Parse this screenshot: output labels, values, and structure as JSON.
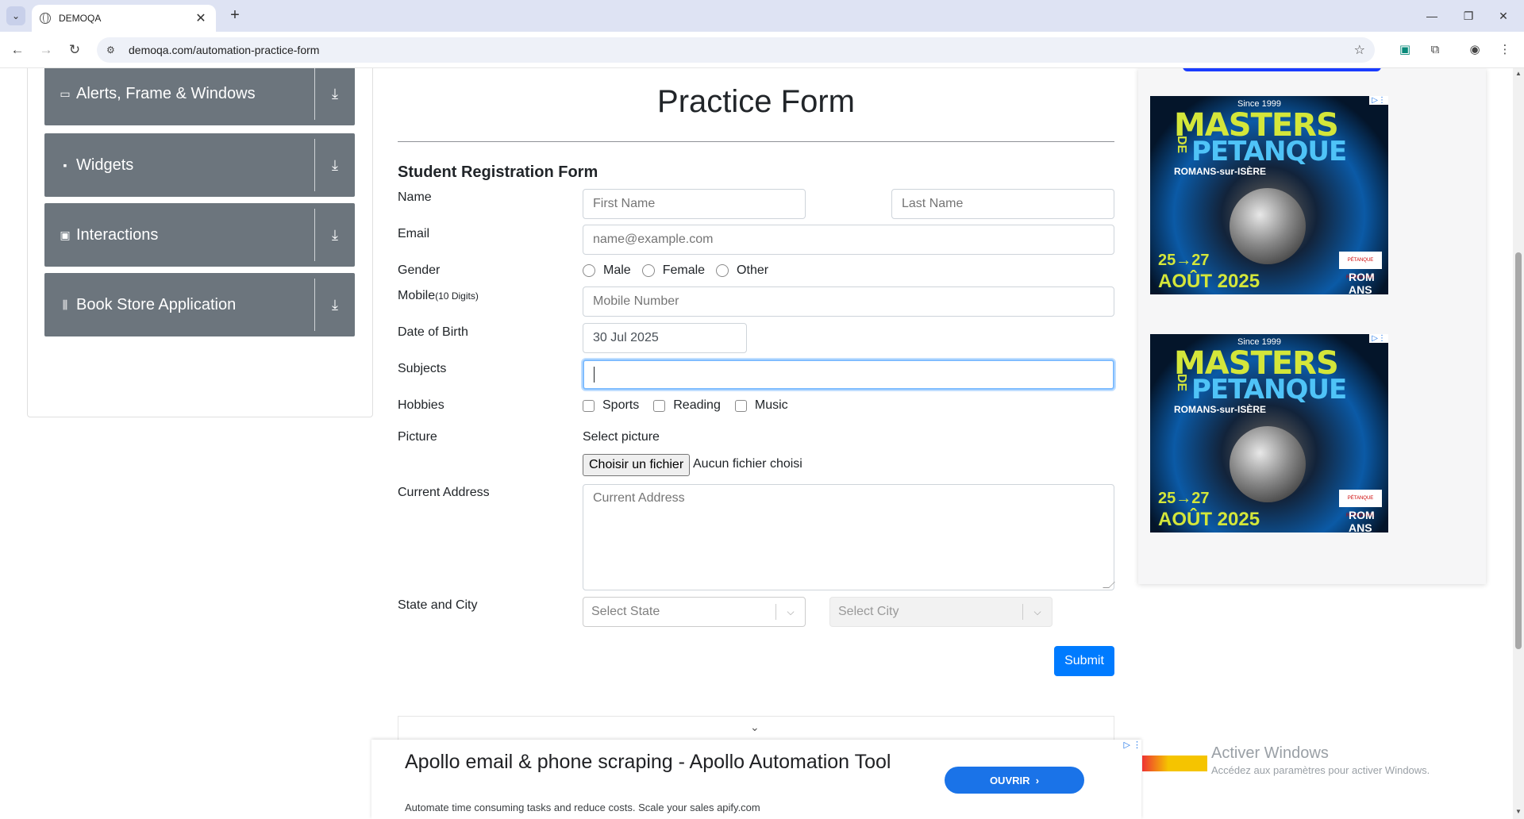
{
  "browser": {
    "tab_title": "DEMOQA",
    "new_tab_glyph": "+",
    "close_glyph": "✕",
    "url": "demoqa.com/automation-practice-form",
    "window_controls": [
      "—",
      "❐",
      "✕"
    ]
  },
  "sidebar": {
    "groups": [
      {
        "label": "Alerts, Frame & Windows",
        "icon": "window-icon"
      },
      {
        "label": "Widgets",
        "icon": "widgets-icon"
      },
      {
        "label": "Interactions",
        "icon": "interactions-icon"
      },
      {
        "label": "Book Store Application",
        "icon": "bookstore-icon"
      }
    ]
  },
  "form": {
    "page_title": "Practice Form",
    "subtitle": "Student Registration Form",
    "labels": {
      "name": "Name",
      "email": "Email",
      "gender": "Gender",
      "mobile": "Mobile",
      "mobile_hint": "(10 Digits)",
      "dob": "Date of Birth",
      "subjects": "Subjects",
      "hobbies": "Hobbies",
      "picture": "Picture",
      "address": "Current Address",
      "state_city": "State and City"
    },
    "placeholders": {
      "first_name": "First Name",
      "last_name": "Last Name",
      "email": "name@example.com",
      "mobile": "Mobile Number",
      "address": "Current Address"
    },
    "dob_value": "30 Jul 2025",
    "gender_options": [
      "Male",
      "Female",
      "Other"
    ],
    "hobby_options": [
      "Sports",
      "Reading",
      "Music"
    ],
    "picture_label": "Select picture",
    "file_button": "Choisir un fichier",
    "file_status": "Aucun fichier choisi",
    "state_placeholder": "Select State",
    "city_placeholder": "Select City",
    "submit": "Submit"
  },
  "ads": {
    "side": {
      "since": "Since 1999",
      "masters": "MASTERS",
      "de": "DE",
      "petanque": "PETANQUE",
      "romans": "ROMANS-sur-ISÈRE",
      "dates": "25→27",
      "month": "AOÛT 2025",
      "rom": "ROM ANS",
      "sponsor": "PÉTANQUE ROMANAISE"
    },
    "bottom": {
      "title": "Apollo email & phone scraping - Apollo Automation Tool",
      "subtitle": "Automate time consuming tasks and reduce costs. Scale your sales apify.com",
      "button": "OUVRIR"
    }
  },
  "watermark": {
    "line1": "Activer Windows",
    "line2": "Accédez aux paramètres pour activer Windows."
  }
}
